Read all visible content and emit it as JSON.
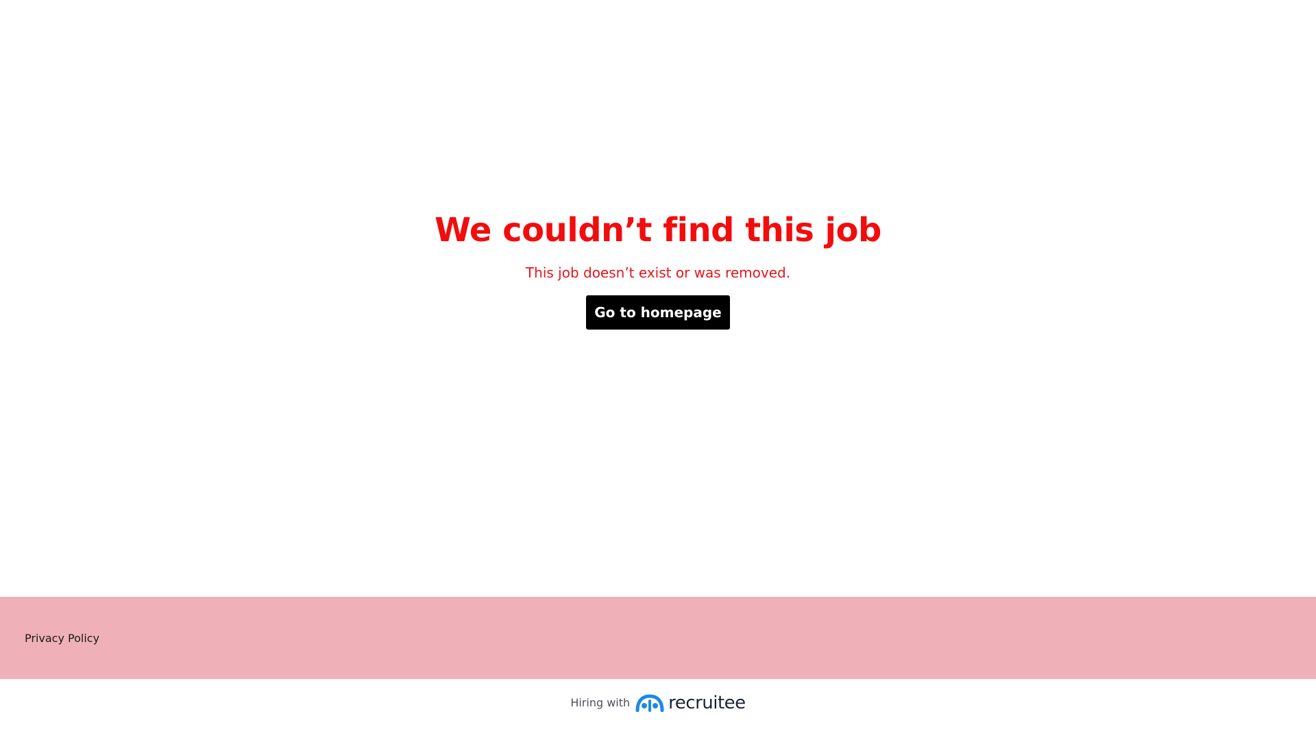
{
  "main": {
    "title": "We couldn’t find this job",
    "subtitle": "This job doesn’t exist or was removed.",
    "home_button_label": "Go to homepage"
  },
  "footer": {
    "privacy_label": "Privacy Policy"
  },
  "powered_by": {
    "hiring_text": "Hiring with",
    "brand_name": "recruitee",
    "logo_icon": "recruitee-logo-icon"
  },
  "colors": {
    "title": "#f20d0d",
    "subtitle": "#e8141a",
    "button_bg": "#000000",
    "button_text": "#ffffff",
    "footer_bg": "#efb1b7",
    "brand_blue": "#1e88e5",
    "brand_text": "#1c2333"
  }
}
